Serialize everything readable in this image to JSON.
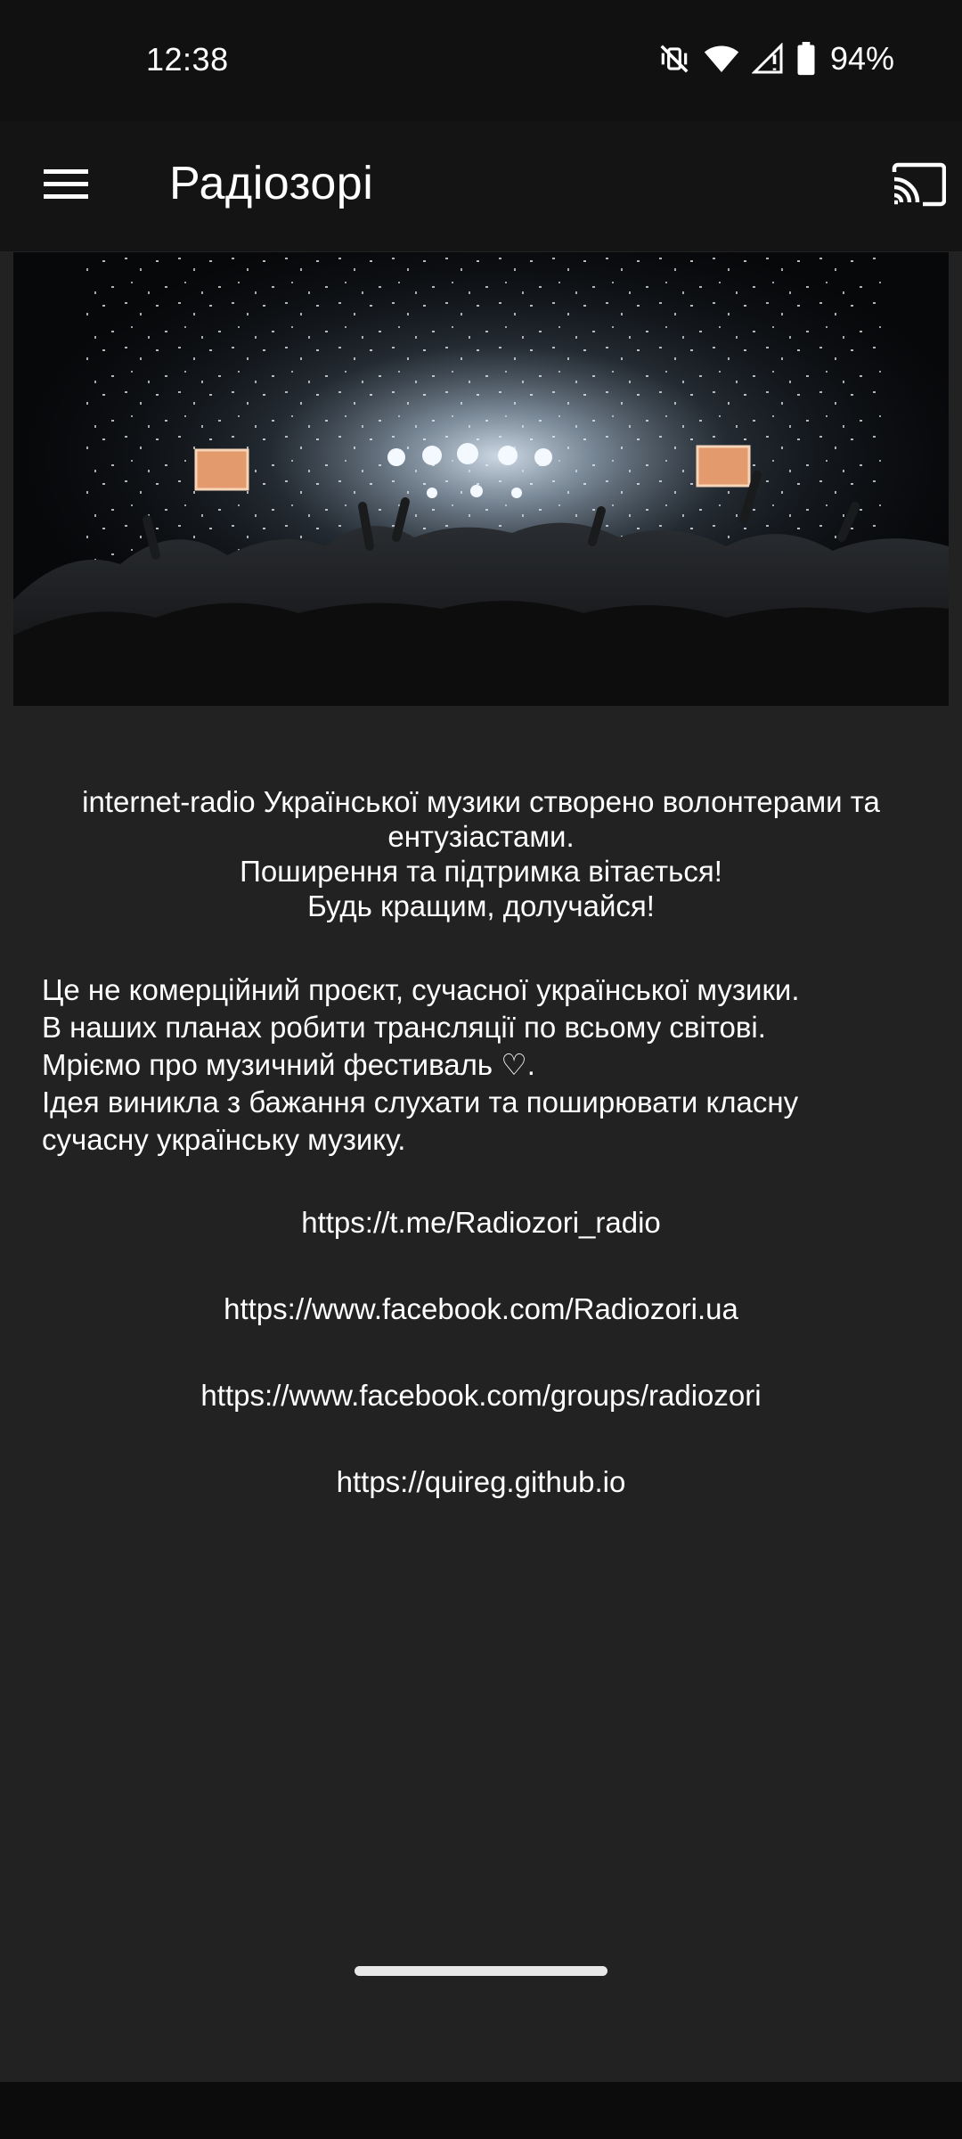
{
  "status_bar": {
    "time": "12:38",
    "battery_percent": "94%",
    "icons": [
      "vibrate-off-icon",
      "wifi-icon",
      "cell-signal-icon",
      "battery-icon"
    ]
  },
  "app_bar": {
    "title": "Радіозорі",
    "menu_icon": "hamburger-menu-icon",
    "cast_icon": "cast-icon"
  },
  "hero_image": {
    "description_icon": "concert-crowd-image"
  },
  "intro": {
    "line1": "internet-radio Української  музики створено волонтерами та",
    "line2": "ентузіастами.",
    "line3": "Поширення та підтримка вітається!",
    "line4": "Будь кращим, долучайся!"
  },
  "description": {
    "line1": "Це не комерційний проєкт, сучасної української музики.",
    "line2": "В наших планах робити трансляції по всьому світові.",
    "line3": "Мріємо про музичний фестиваль ♡.",
    "line4": "Ідея виникла з бажання слухати та поширювати класну",
    "line5": "сучасну українську музику."
  },
  "links": [
    "https://t.me/Radiozori_radio",
    "https://www.facebook.com/Radiozori.ua",
    "https://www.facebook.com/groups/radiozori",
    "https://quireg.github.io"
  ],
  "colors": {
    "background": "#222222",
    "status_bar": "#111111",
    "app_bar": "#141414",
    "text": "#ffffff"
  }
}
